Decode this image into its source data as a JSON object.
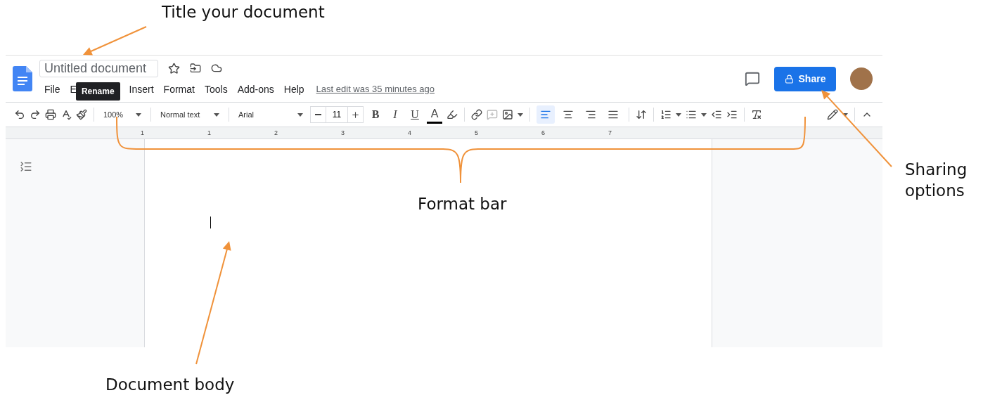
{
  "annotations": [
    {
      "kind": "title",
      "text": "Title your document"
    },
    {
      "kind": "format",
      "text": "Format bar"
    },
    {
      "kind": "sharing",
      "text": "Sharing options"
    },
    {
      "kind": "body",
      "text": "Document body"
    }
  ],
  "header": {
    "title_placeholder": "Untitled document",
    "tooltip": "Rename",
    "menu": [
      "File",
      "E",
      "Insert",
      "Format",
      "Tools",
      "Add-ons",
      "Help"
    ],
    "last_edit": "Last edit was 35 minutes ago",
    "share": "Share"
  },
  "toolbar": {
    "zoom": "100%",
    "style": "Normal text",
    "font": "Arial",
    "font_size": "11",
    "format_buttons": [
      {
        "kind": "bold",
        "label": "B"
      },
      {
        "kind": "italic",
        "label": "I"
      },
      {
        "kind": "underline",
        "label": "U"
      },
      {
        "kind": "color",
        "label": "A"
      }
    ],
    "alignments": [
      {
        "kind": "left",
        "selected": true
      },
      {
        "kind": "center",
        "selected": false
      },
      {
        "kind": "right",
        "selected": false
      },
      {
        "kind": "justify",
        "selected": false
      }
    ]
  },
  "ruler": [
    "1",
    "1",
    "2",
    "3",
    "4",
    "5",
    "6",
    "7"
  ]
}
